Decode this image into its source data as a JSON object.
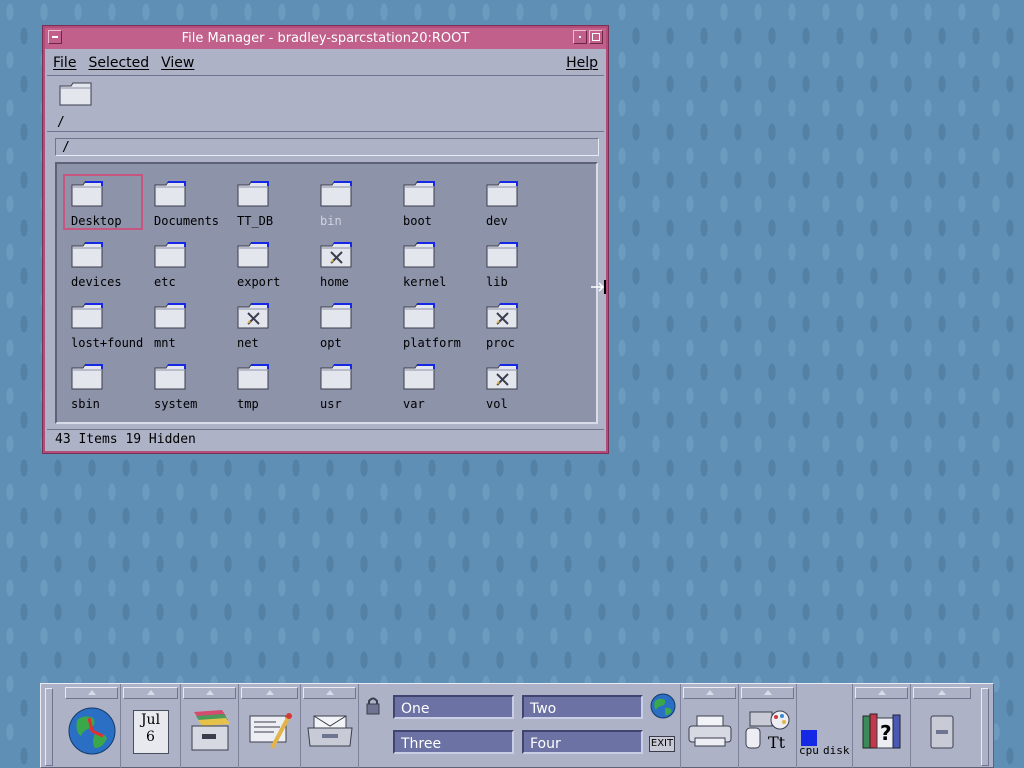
{
  "window": {
    "title": "File Manager - bradley-sparcstation20:ROOT",
    "menu": {
      "file": "File",
      "selected": "Selected",
      "view": "View",
      "help": "Help"
    },
    "path_label": "/",
    "path_field": "/",
    "status": "43 Items 19 Hidden"
  },
  "files": [
    {
      "name": "Desktop",
      "type": "folder",
      "selected": true
    },
    {
      "name": "Documents",
      "type": "folder"
    },
    {
      "name": "TT_DB",
      "type": "folder"
    },
    {
      "name": "bin",
      "type": "folder",
      "dim": true
    },
    {
      "name": "boot",
      "type": "folder"
    },
    {
      "name": "dev",
      "type": "folder"
    },
    {
      "name": "devices",
      "type": "folder"
    },
    {
      "name": "etc",
      "type": "folder"
    },
    {
      "name": "export",
      "type": "folder"
    },
    {
      "name": "home",
      "type": "folder-locked"
    },
    {
      "name": "kernel",
      "type": "folder"
    },
    {
      "name": "lib",
      "type": "folder"
    },
    {
      "name": "lost+found",
      "type": "folder"
    },
    {
      "name": "mnt",
      "type": "folder"
    },
    {
      "name": "net",
      "type": "folder-locked"
    },
    {
      "name": "opt",
      "type": "folder"
    },
    {
      "name": "platform",
      "type": "folder"
    },
    {
      "name": "proc",
      "type": "folder-locked"
    },
    {
      "name": "sbin",
      "type": "folder"
    },
    {
      "name": "system",
      "type": "folder"
    },
    {
      "name": "tmp",
      "type": "folder"
    },
    {
      "name": "usr",
      "type": "folder"
    },
    {
      "name": "var",
      "type": "folder"
    },
    {
      "name": "vol",
      "type": "folder-locked"
    }
  ],
  "front_panel": {
    "calendar": {
      "month": "Jul",
      "day": "6"
    },
    "workspaces": [
      "One",
      "Two",
      "Three",
      "Four"
    ],
    "active_workspace": "One",
    "exit_label": "EXIT",
    "cpu_label": "cpu",
    "disk_label": "disk"
  }
}
